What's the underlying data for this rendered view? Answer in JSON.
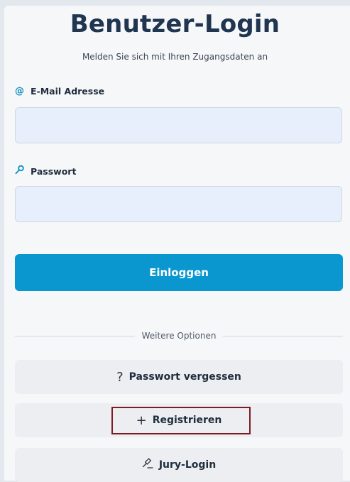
{
  "header": {
    "title": "Benutzer-Login",
    "subtitle": "Melden Sie sich mit Ihren Zugangsdaten an"
  },
  "form": {
    "email": {
      "icon": "at-icon",
      "icon_glyph": "@",
      "label": "E-Mail Adresse",
      "value": "",
      "placeholder": ""
    },
    "password": {
      "icon": "key-icon",
      "label": "Passwort",
      "value": "",
      "placeholder": ""
    },
    "login_label": "Einloggen"
  },
  "options": {
    "divider_label": "Weitere Optionen",
    "forgot_password": {
      "icon": "question-icon",
      "icon_glyph": "?",
      "label": "Passwort vergessen"
    },
    "register": {
      "icon": "plus-icon",
      "icon_glyph": "+",
      "label": "Registrieren"
    },
    "jury_login": {
      "icon": "gavel-icon",
      "label": "Jury-Login"
    }
  },
  "colors": {
    "accent": "#0a97d0",
    "title": "#1f3550",
    "input_bg": "#e8effc",
    "highlight": "#7d1a24"
  }
}
